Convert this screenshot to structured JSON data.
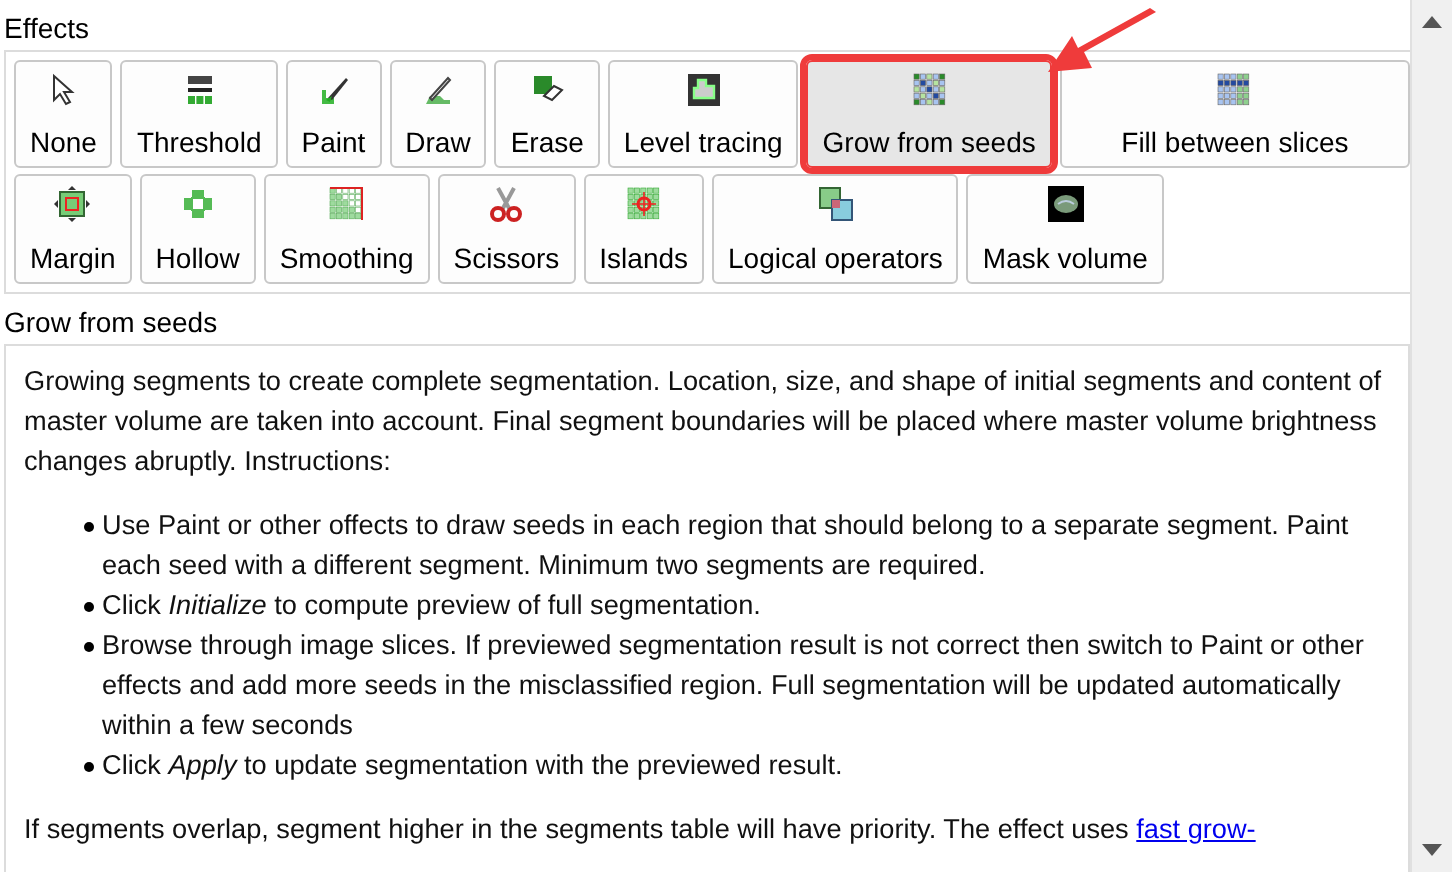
{
  "effects_group": {
    "title": "Effects",
    "upper_buttons": [
      {
        "label": "None",
        "selected": false,
        "highlighted": false
      },
      {
        "label": "Threshold",
        "selected": false,
        "highlighted": false
      },
      {
        "label": "Paint",
        "selected": false,
        "highlighted": false
      },
      {
        "label": "Draw",
        "selected": false,
        "highlighted": false
      },
      {
        "label": "Erase",
        "selected": false,
        "highlighted": false
      },
      {
        "label": "Level tracing",
        "selected": false,
        "highlighted": false
      },
      {
        "label": "Grow from seeds",
        "selected": true,
        "highlighted": true
      },
      {
        "label": "Fill between slices",
        "selected": false,
        "highlighted": false
      }
    ],
    "lower_buttons": [
      {
        "label": "Margin",
        "selected": false,
        "highlighted": false
      },
      {
        "label": "Hollow",
        "selected": false,
        "highlighted": false
      },
      {
        "label": "Smoothing",
        "selected": false,
        "highlighted": false
      },
      {
        "label": "Scissors",
        "selected": false,
        "highlighted": false
      },
      {
        "label": "Islands",
        "selected": false,
        "highlighted": false
      },
      {
        "label": "Logical operators",
        "selected": false,
        "highlighted": false
      },
      {
        "label": "Mask volume",
        "selected": false,
        "highlighted": false
      }
    ]
  },
  "description": {
    "title": "Grow from seeds",
    "intro": "Growing segments to create complete segmentation. Location, size, and shape of initial segments and content of master volume are taken into account. Final segment boundaries will be placed where master volume brightness changes abruptly. Instructions:",
    "steps": [
      "Use Paint or other offects to draw seeds in each region that should belong to a separate segment. Paint each seed with a different segment. Minimum two segments are required.",
      "Click *Initialize* to compute preview of full segmentation.",
      "Browse through image slices. If previewed segmentation result is not correct then switch to Paint or other effects and add more seeds in the misclassified region. Full segmentation will be updated automatically within a few seconds",
      "Click *Apply* to update segmentation with the previewed result."
    ],
    "footer": "If segments overlap, segment higher in the segments table will have priority. The effect uses",
    "footer_link": "fast grow-"
  }
}
